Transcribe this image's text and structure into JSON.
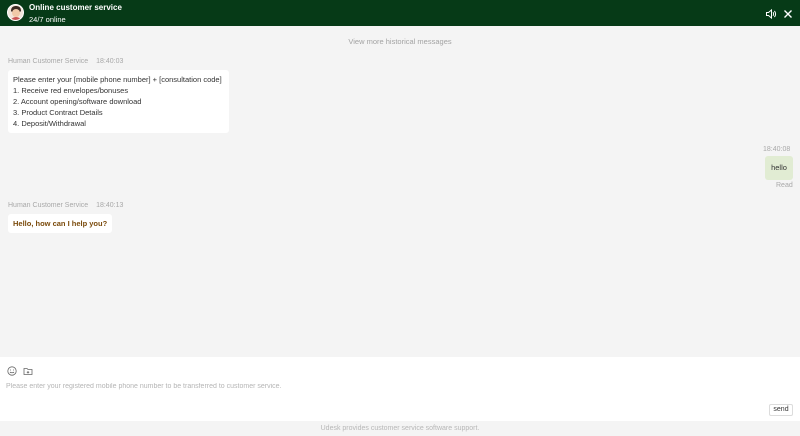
{
  "header": {
    "title": "Online customer service",
    "status": "24/7 online",
    "background": "#063a17"
  },
  "chat": {
    "history_link": "View more historical messages",
    "messages": [
      {
        "sender": "Human Customer Service",
        "time": "18:40:03",
        "lines": [
          "Please enter your [mobile phone number] + [consultation code]",
          "1. Receive red envelopes/bonuses",
          "2. Account opening/software download",
          "3. Product Contract Details",
          "4. Deposit/Withdrawal"
        ]
      },
      {
        "sender": "user",
        "time": "18:40:08",
        "text": "hello",
        "read_label": "Read"
      },
      {
        "sender": "Human Customer Service",
        "time": "18:40:13",
        "text": "Hello, how can I help you?"
      }
    ]
  },
  "composer": {
    "placeholder": "Please enter your registered mobile phone number to be transferred to customer service.",
    "value": "",
    "send_label": "send",
    "icons": [
      "emoji-icon",
      "folder-icon"
    ]
  },
  "footer": {
    "text": "Udesk provides customer service software support."
  }
}
